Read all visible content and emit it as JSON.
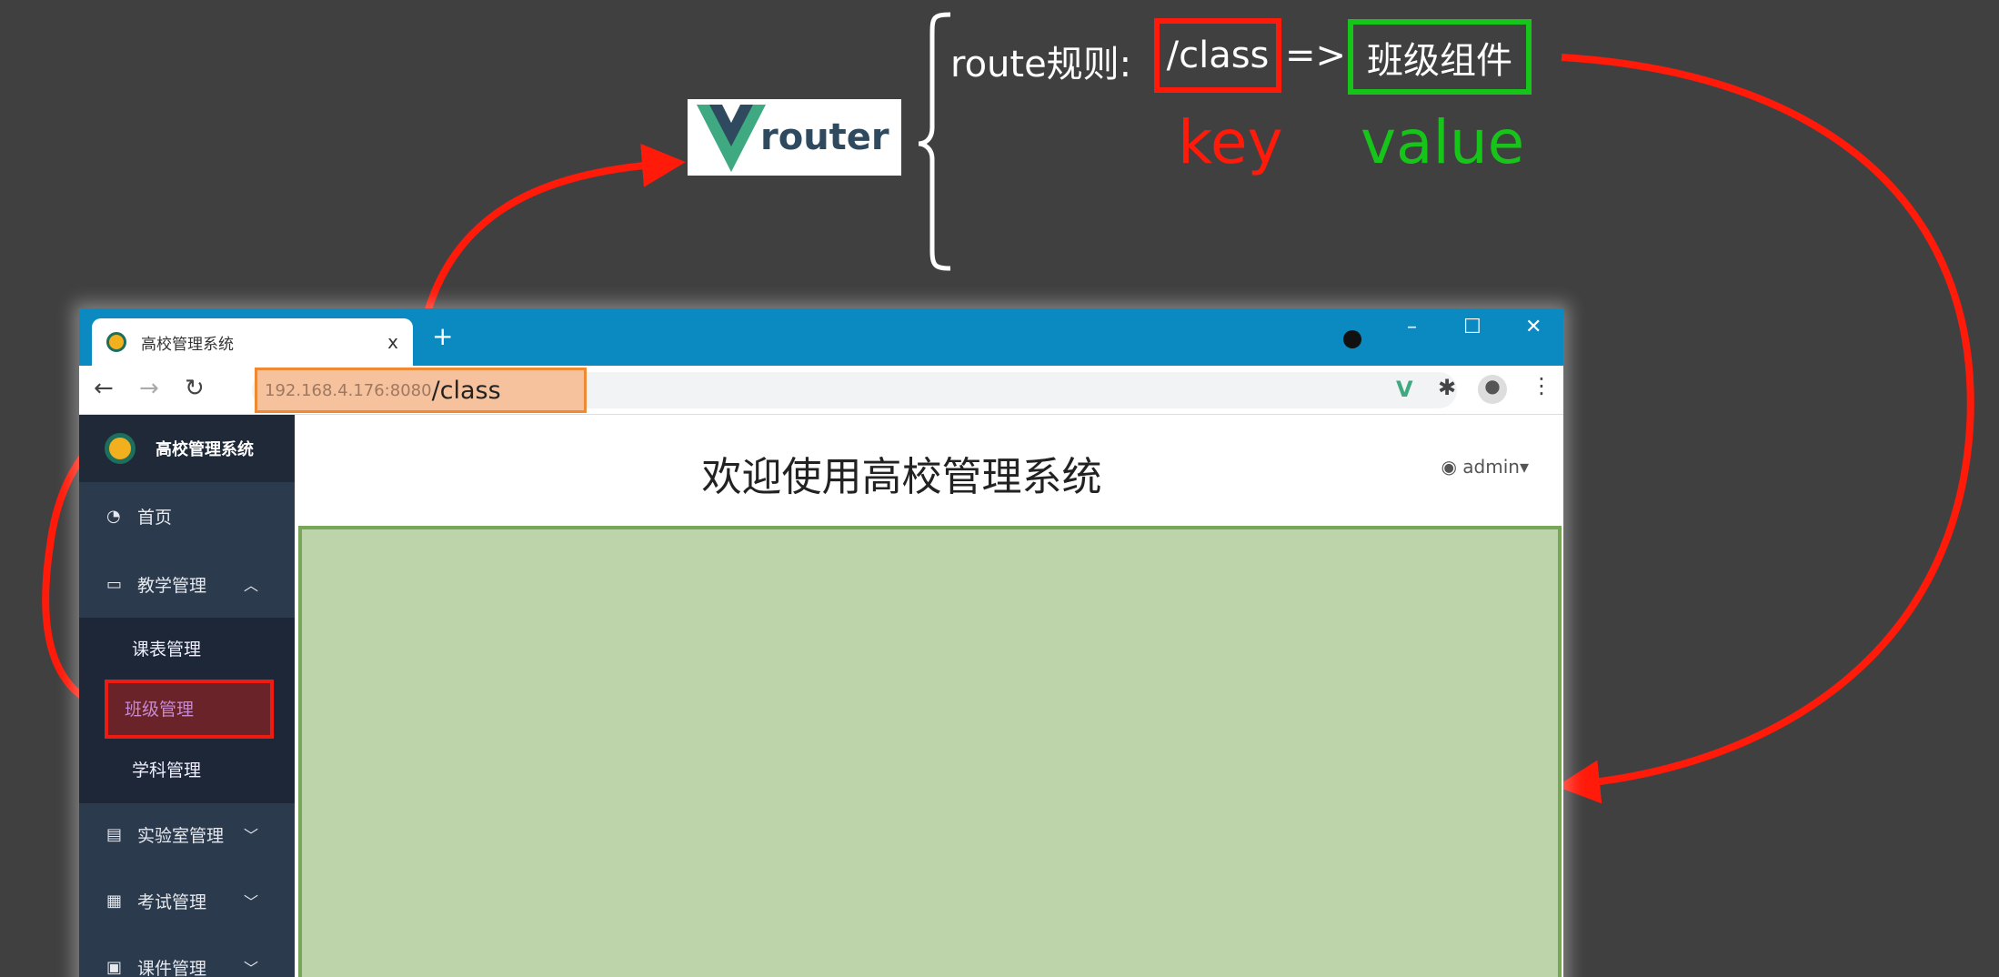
{
  "annotation": {
    "logo": "router",
    "rule_label": "route规则:",
    "key_path": "/class",
    "arrow": "=>",
    "component": "班级组件",
    "key_label": "key",
    "value_label": "value",
    "colors": {
      "key": "#ff1a0a",
      "value": "#17c41a",
      "arrow": "#ff1a0a"
    }
  },
  "browser": {
    "tab_title": "高校管理系统",
    "tab_close": "x",
    "new_tab": "+",
    "url_host": "192.168.4.176:8080",
    "url_path": "/class",
    "minimize": "–",
    "maximize": "☐",
    "close": "✕"
  },
  "sidebar": {
    "title": "高校管理系统",
    "items": [
      {
        "label": "首页",
        "icon": "dashboard-icon"
      },
      {
        "label": "教学管理",
        "icon": "monitor-icon",
        "expanded": true
      },
      {
        "label": "实验室管理",
        "icon": "document-icon"
      },
      {
        "label": "考试管理",
        "icon": "printer-icon"
      },
      {
        "label": "课件管理",
        "icon": "word-icon"
      }
    ],
    "sub_items": [
      "课表管理",
      "班级管理",
      "学科管理"
    ],
    "active": "班级管理"
  },
  "header": {
    "title": "欢迎使用高校管理系统",
    "user": "admin"
  }
}
